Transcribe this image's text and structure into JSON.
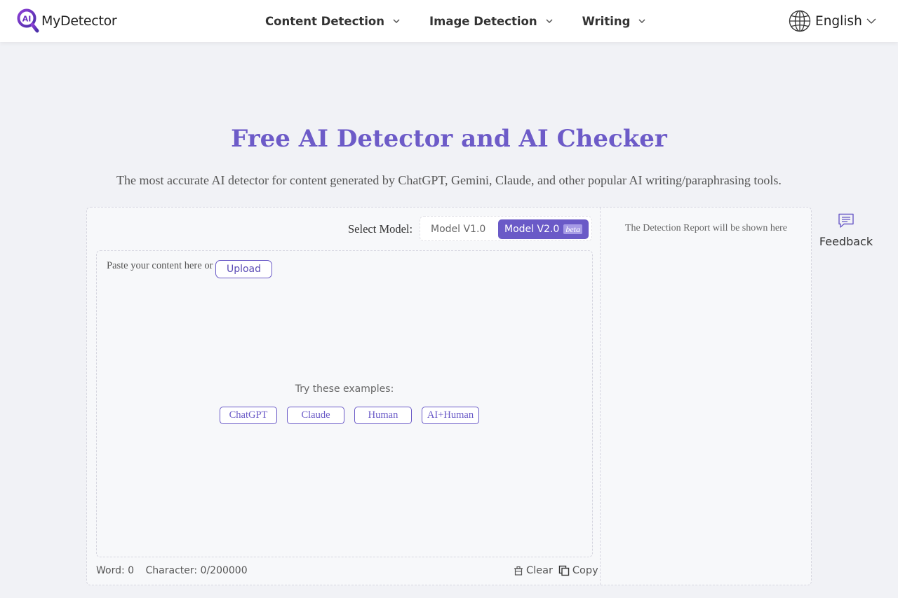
{
  "header": {
    "logo_badge": "AI",
    "logo_text": "MyDetector",
    "nav": [
      {
        "label": "Content Detection"
      },
      {
        "label": "Image Detection"
      },
      {
        "label": "Writing"
      }
    ],
    "language": "English"
  },
  "hero": {
    "title": "Free AI Detector and AI Checker",
    "subtitle": "The most accurate AI detector for content generated by ChatGPT, Gemini, Claude, and other popular AI writing/paraphrasing tools."
  },
  "model": {
    "label": "Select Model:",
    "options": [
      "Model V1.0",
      "Model V2.0"
    ],
    "selected": "Model V2.0",
    "badge": "beta"
  },
  "editor": {
    "placeholder": "Paste your content here or",
    "upload_label": "Upload",
    "examples_label": "Try these examples:",
    "examples": [
      "ChatGPT",
      "Claude",
      "Human",
      "AI+Human"
    ]
  },
  "footer": {
    "word_count": "Word: 0",
    "char_count": "Character: 0/200000",
    "clear_label": "Clear",
    "copy_label": "Copy"
  },
  "report": {
    "placeholder": "The Detection Report will be shown here"
  },
  "feedback": {
    "label": "Feedback"
  },
  "colors": {
    "accent": "#6a5ac7",
    "title": "#6d5bc8",
    "background": "#f1f2f6"
  }
}
